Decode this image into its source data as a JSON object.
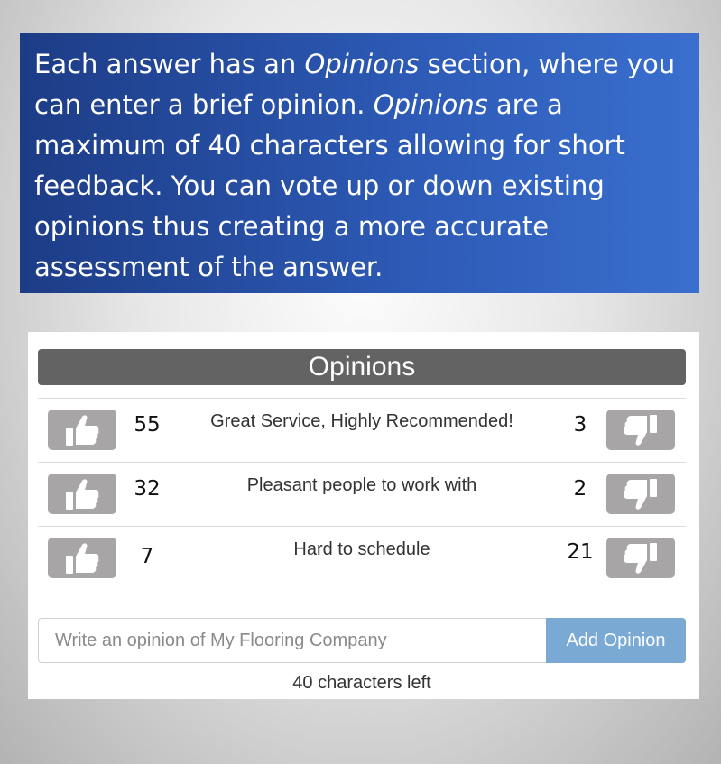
{
  "intro": {
    "segments": [
      {
        "text": "Each answer has an ",
        "italic": false
      },
      {
        "text": "Opinions",
        "italic": true
      },
      {
        "text": " section, where you can enter a brief opinion. ",
        "italic": false
      },
      {
        "text": "Opinions",
        "italic": true
      },
      {
        "text": " are a maximum of 40 characters allowing for short feedback. You can vote up or down existing opinions thus creating a more accurate assessment of the answer.",
        "italic": false
      }
    ]
  },
  "panel": {
    "title": "Opinions",
    "opinions": [
      {
        "up_votes": "55",
        "text": "Great Service, Highly Recommended!",
        "down_votes": "3"
      },
      {
        "up_votes": "32",
        "text": "Pleasant people to work with",
        "down_votes": "2"
      },
      {
        "up_votes": "7",
        "text": "Hard to schedule",
        "down_votes": "21"
      }
    ],
    "input": {
      "placeholder": "Write an opinion of My Flooring Company",
      "value": ""
    },
    "add_button_label": "Add Opinion",
    "chars_left": "40 characters left"
  },
  "icons": {
    "upvote": "thumbs-up-icon",
    "downvote": "thumbs-down-icon"
  },
  "colors": {
    "vote_button": "#a7a5a5",
    "header_bg": "#636363",
    "add_button": "#7aaad3",
    "intro_bg": "#2c59b4"
  }
}
